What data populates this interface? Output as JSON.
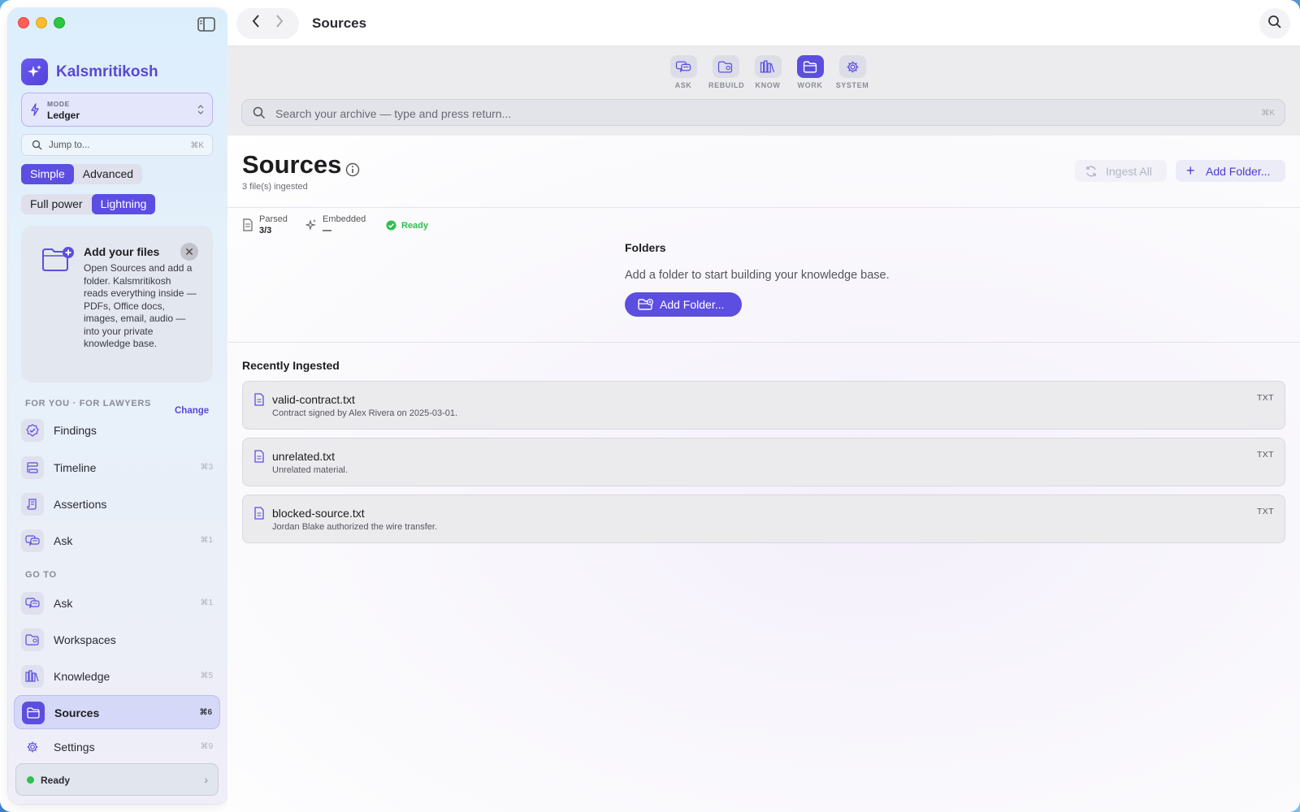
{
  "sidebar": {
    "brand": "Kalsmritikosh",
    "mode": {
      "caption": "MODE",
      "value": "Ledger"
    },
    "jump": {
      "placeholder": "Jump to...",
      "shortcut": "⌘K"
    },
    "complexity": {
      "options": [
        "Simple",
        "Advanced"
      ],
      "selected": "Simple"
    },
    "power": {
      "options": [
        "Full power",
        "Lightning"
      ],
      "selected": "Lightning"
    },
    "card": {
      "title": "Add your files",
      "body": "Open Sources and add a folder. Kalsmritikosh reads everything inside — PDFs, Office docs, images, email, audio — into your private knowledge base.",
      "close": "✕"
    },
    "for_you": {
      "label": "FOR YOU · FOR LAWYERS",
      "change": "Change",
      "items": [
        {
          "label": "Findings",
          "shortcut": "",
          "icon": "findings-badge-icon"
        },
        {
          "label": "Timeline",
          "shortcut": "⌘3",
          "icon": "timeline-icon"
        },
        {
          "label": "Assertions",
          "shortcut": "",
          "icon": "assertions-scroll-icon"
        },
        {
          "label": "Ask",
          "shortcut": "⌘1",
          "icon": "chat-bubbles-icon"
        }
      ]
    },
    "go_to": {
      "label": "GO TO",
      "items": [
        {
          "label": "Ask",
          "shortcut": "⌘1",
          "icon": "chat-bubbles-icon"
        },
        {
          "label": "Workspaces",
          "shortcut": "",
          "icon": "folder-gear-icon"
        },
        {
          "label": "Knowledge",
          "shortcut": "⌘5",
          "icon": "books-icon"
        },
        {
          "label": "Sources",
          "shortcut": "⌘6",
          "icon": "folder-icon",
          "active": true
        },
        {
          "label": "Settings",
          "shortcut": "⌘9",
          "icon": "gear-icon"
        }
      ]
    },
    "status": "Ready"
  },
  "topbar": {
    "title": "Sources"
  },
  "tabs": [
    {
      "label": "ASK",
      "icon": "chat-bubbles-icon"
    },
    {
      "label": "REBUILD",
      "icon": "folder-gear-icon"
    },
    {
      "label": "KNOW",
      "icon": "books-icon"
    },
    {
      "label": "WORK",
      "icon": "folder-icon",
      "active": true
    },
    {
      "label": "SYSTEM",
      "icon": "gear-icon"
    }
  ],
  "archive_search": {
    "placeholder": "Search your archive — type and press return...",
    "shortcut": "⌘K"
  },
  "page": {
    "title": "Sources",
    "count": "3 file(s) ingested",
    "ingest_all": "Ingest All",
    "add_folder": "Add Folder...",
    "stats": {
      "parsed_label": "Parsed",
      "parsed_value": "3/3",
      "embedded_label": "Embedded",
      "embedded_value": "—",
      "status": "Ready"
    },
    "folders": {
      "title": "Folders",
      "desc": "Add a folder to start building your knowledge base.",
      "button": "Add Folder..."
    },
    "recent": {
      "title": "Recently Ingested",
      "files": [
        {
          "name": "valid-contract.txt",
          "desc": "Contract signed by Alex Rivera on 2025-03-01.",
          "type": "TXT"
        },
        {
          "name": "unrelated.txt",
          "desc": "Unrelated material.",
          "type": "TXT"
        },
        {
          "name": "blocked-source.txt",
          "desc": "Jordan Blake authorized the wire transfer.",
          "type": "TXT"
        }
      ]
    }
  },
  "colors": {
    "accent": "#5c4ee0",
    "ready": "#2ebf4f"
  }
}
